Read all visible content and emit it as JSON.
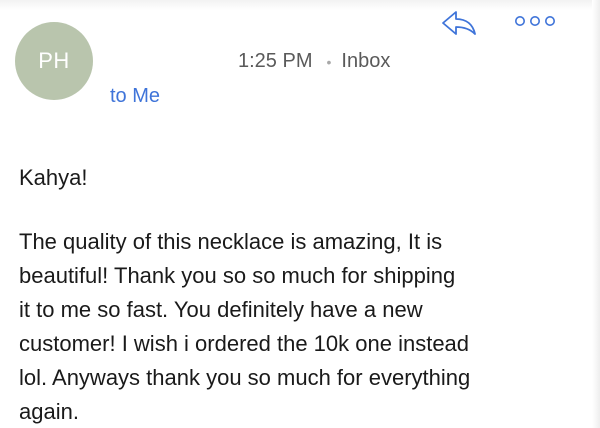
{
  "sender": {
    "initials": "PH"
  },
  "header": {
    "time": "1:25 PM",
    "separator": "•",
    "mailbox": "Inbox",
    "recipient": "to Me"
  },
  "toolbar": {
    "reply_icon": "reply-arrow-icon",
    "more_icon": "more-options-icon"
  },
  "colors": {
    "avatar_bg": "#b9c5ad",
    "accent": "#3f74d9"
  },
  "message": {
    "greeting": "Kahya!",
    "body": "The quality of this necklace is amazing, It is\nbeautiful! Thank you so so much for shipping\nit to me so fast. You definitely have a new\ncustomer! I wish i ordered the 10k one instead\nlol. Anyways thank you so much for everything\nagain."
  }
}
